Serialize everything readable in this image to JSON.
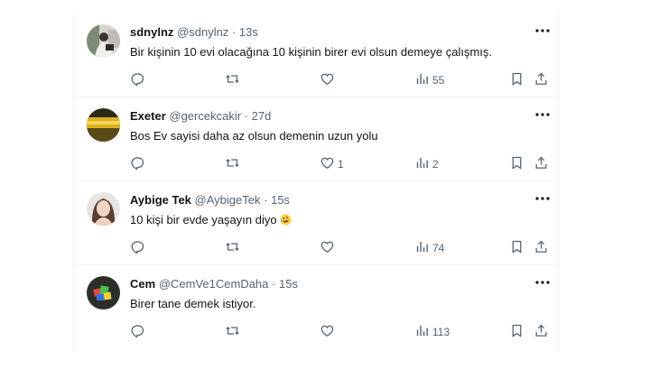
{
  "tweets": [
    {
      "name": "sdnylnz",
      "handle": "@sdnylnz",
      "dot": "·",
      "time": "13s",
      "text": "Bir kişinin 10 evi olacağına 10 kişinin birer evi olsun demeye çalışmış.",
      "like_count": "",
      "view_count": "55"
    },
    {
      "name": "Exeter",
      "handle": "@gercekcakir",
      "dot": "·",
      "time": "27d",
      "text": "Bos Ev sayisi daha az olsun demenin uzun yolu",
      "like_count": "1",
      "view_count": "2"
    },
    {
      "name": "Aybige Tek",
      "handle": "@AybigeTek",
      "dot": "·",
      "time": "15s",
      "text": "10 kişi bir evde yaşayın diyo",
      "like_count": "",
      "view_count": "74"
    },
    {
      "name": "Cem",
      "handle": "@CemVe1CemDaha",
      "dot": "·",
      "time": "15s",
      "text": "Birer tane demek istiyor.",
      "like_count": "",
      "view_count": "113"
    }
  ],
  "icons": {
    "reply": "reply-icon",
    "retweet": "retweet-icon",
    "like": "heart-icon",
    "views": "views-icon",
    "bookmark": "bookmark-icon",
    "share": "share-icon",
    "more": "more-icon",
    "emoji": "rolling-laughing-emoji"
  },
  "colors": {
    "text": "#0f1419",
    "secondary": "#536471",
    "divider": "#eff3f4"
  }
}
